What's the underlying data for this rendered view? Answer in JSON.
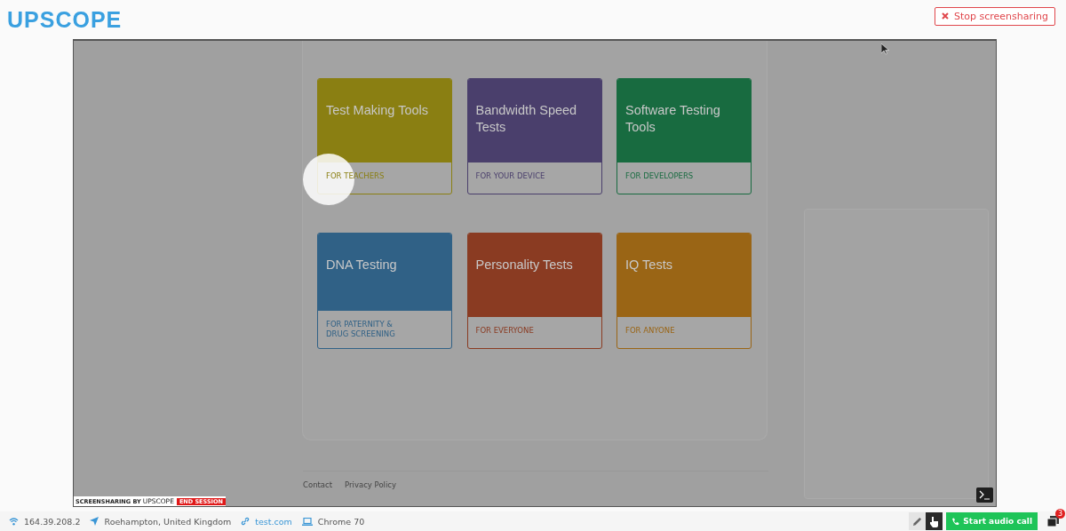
{
  "header": {
    "logo": "UPSCOPE",
    "stop_button": "Stop screensharing"
  },
  "shared_screen": {
    "cards": [
      {
        "title": "Test Making Tools",
        "subtitle": "FOR TEACHERS",
        "color": "#8a7f12"
      },
      {
        "title": "Bandwidth Speed Tests",
        "subtitle": "FOR YOUR DEVICE",
        "color": "#4a3f6c"
      },
      {
        "title": "Software Testing Tools",
        "subtitle": "FOR DEVELOPERS",
        "color": "#186b40"
      },
      {
        "title": "DNA Testing",
        "subtitle": "FOR PATERNITY & DRUG SCREENING",
        "color": "#306186"
      },
      {
        "title": "Personality Tests",
        "subtitle": "FOR EVERYONE",
        "color": "#8a3b22"
      },
      {
        "title": "IQ Tests",
        "subtitle": "FOR ANYONE",
        "color": "#9a6515"
      }
    ],
    "footer_links": [
      "Contact",
      "Privacy Policy"
    ],
    "watermark": {
      "label": "SCREENSHARING BY",
      "brand": "UPSCOPE",
      "end_session": "END SESSION"
    }
  },
  "status_bar": {
    "ip": "164.39.208.2",
    "location": "Roehampton, United Kingdom",
    "url": "test.com",
    "browser": "Chrome 70",
    "tools": [
      {
        "kind": "pencil",
        "selected": false
      },
      {
        "kind": "pointer",
        "selected": true
      }
    ],
    "audio_button": "Start audio call",
    "notification_count": "3"
  }
}
